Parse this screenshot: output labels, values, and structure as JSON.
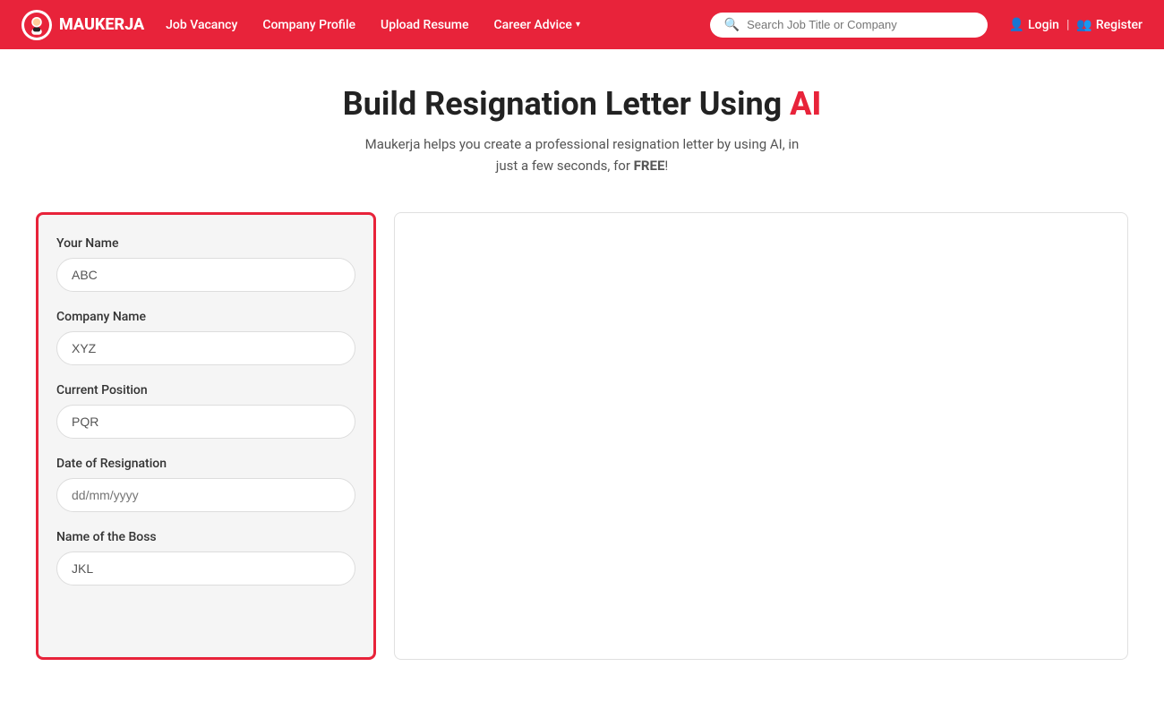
{
  "brand": {
    "name": "MAUKERJA"
  },
  "navbar": {
    "links": [
      {
        "label": "Job Vacancy",
        "id": "job-vacancy",
        "dropdown": false
      },
      {
        "label": "Company Profile",
        "id": "company-profile",
        "dropdown": false
      },
      {
        "label": "Upload Resume",
        "id": "upload-resume",
        "dropdown": false
      },
      {
        "label": "Career Advice",
        "id": "career-advice",
        "dropdown": true
      }
    ],
    "search_placeholder": "Search Job Title or Company",
    "login_label": "Login",
    "register_label": "Register"
  },
  "hero": {
    "title_part1": "Build Resignation Letter Using ",
    "title_ai": "AI",
    "subtitle": "Maukerja helps you create a professional resignation letter by using AI, in just a few seconds, for ",
    "subtitle_bold": "FREE",
    "subtitle_end": "!"
  },
  "form": {
    "fields": [
      {
        "label": "Your Name",
        "id": "your-name",
        "value": "ABC",
        "placeholder": ""
      },
      {
        "label": "Company Name",
        "id": "company-name",
        "value": "XYZ",
        "placeholder": ""
      },
      {
        "label": "Current Position",
        "id": "current-position",
        "value": "PQR",
        "placeholder": ""
      },
      {
        "label": "Date of Resignation",
        "id": "date-of-resignation",
        "value": "",
        "placeholder": "dd/mm/yyyy"
      },
      {
        "label": "Name of the Boss",
        "id": "name-of-boss",
        "value": "JKL",
        "placeholder": ""
      }
    ]
  },
  "colors": {
    "brand_red": "#e8233a",
    "text_dark": "#222222",
    "text_muted": "#555555"
  }
}
